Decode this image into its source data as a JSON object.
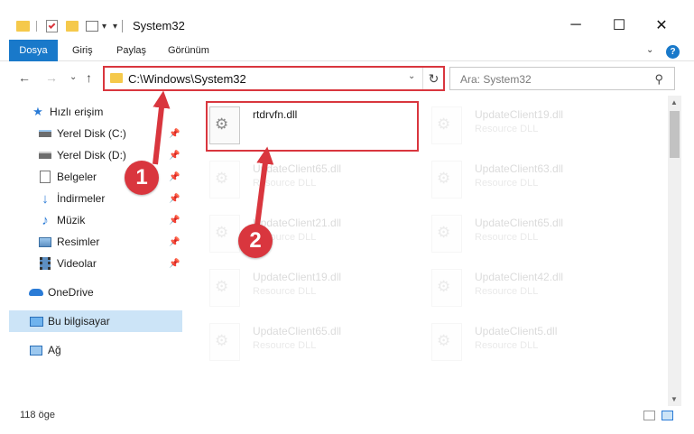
{
  "window": {
    "title": "System32",
    "minimize_glyph": "─",
    "maximize_glyph": "☐",
    "close_glyph": "✕"
  },
  "quick_access": {
    "dropdown_glyph": "▾"
  },
  "ribbon": {
    "tabs": [
      "Dosya",
      "Giriş",
      "Paylaş",
      "Görünüm"
    ],
    "help_glyph": "?",
    "collapse_glyph": "⌄"
  },
  "nav": {
    "back_glyph": "←",
    "forward_glyph": "→",
    "recent_glyph": "⌄",
    "up_glyph": "↑",
    "address": "C:\\Windows\\System32",
    "address_dropdown_glyph": "⌄",
    "refresh_glyph": "↻",
    "search_placeholder": "Ara: System32",
    "search_glyph": "⚲"
  },
  "sidebar": {
    "items": [
      {
        "label": "Hızlı erişim",
        "icon": "star-icon"
      },
      {
        "label": "Yerel Disk (C:)",
        "icon": "drive-icon",
        "pinned": true
      },
      {
        "label": "Yerel Disk (D:)",
        "icon": "drive-icon",
        "pinned": true
      },
      {
        "label": "Belgeler",
        "icon": "documents-icon",
        "pinned": true
      },
      {
        "label": "İndirmeler",
        "icon": "download-icon",
        "pinned": true
      },
      {
        "label": "Müzik",
        "icon": "music-icon",
        "pinned": true
      },
      {
        "label": "Resimler",
        "icon": "pictures-icon",
        "pinned": true
      },
      {
        "label": "Videolar",
        "icon": "videos-icon",
        "pinned": true
      },
      {
        "label": "OneDrive",
        "icon": "onedrive-icon"
      },
      {
        "label": "Bu bilgisayar",
        "icon": "computer-icon",
        "selected": true
      },
      {
        "label": "Ağ",
        "icon": "network-icon"
      }
    ],
    "pin_glyph": "📌"
  },
  "files": [
    {
      "name": "rtdrvfn.dll",
      "type": ""
    },
    {
      "name": "UpdateClient19.dll",
      "type": "Resource DLL"
    },
    {
      "name": "UpdateClient65.dll",
      "type": "Resource DLL"
    },
    {
      "name": "UpdateClient63.dll",
      "type": "Resource DLL"
    },
    {
      "name": "UpdateClient21.dll",
      "type": "Resource DLL"
    },
    {
      "name": "UpdateClient65.dll",
      "type": "Resource DLL"
    },
    {
      "name": "UpdateClient19.dll",
      "type": "Resource DLL"
    },
    {
      "name": "UpdateClient42.dll",
      "type": "Resource DLL"
    },
    {
      "name": "UpdateClient65.dll",
      "type": "Resource DLL"
    },
    {
      "name": "UpdateClient5.dll",
      "type": "Resource DLL"
    }
  ],
  "status": {
    "item_count": "118 öge"
  },
  "annotations": {
    "marker_1": "1",
    "marker_2": "2",
    "color": "#d9363e"
  },
  "colors": {
    "accent": "#1979ca",
    "selection": "#cce4f7",
    "folder": "#f5c94b"
  }
}
